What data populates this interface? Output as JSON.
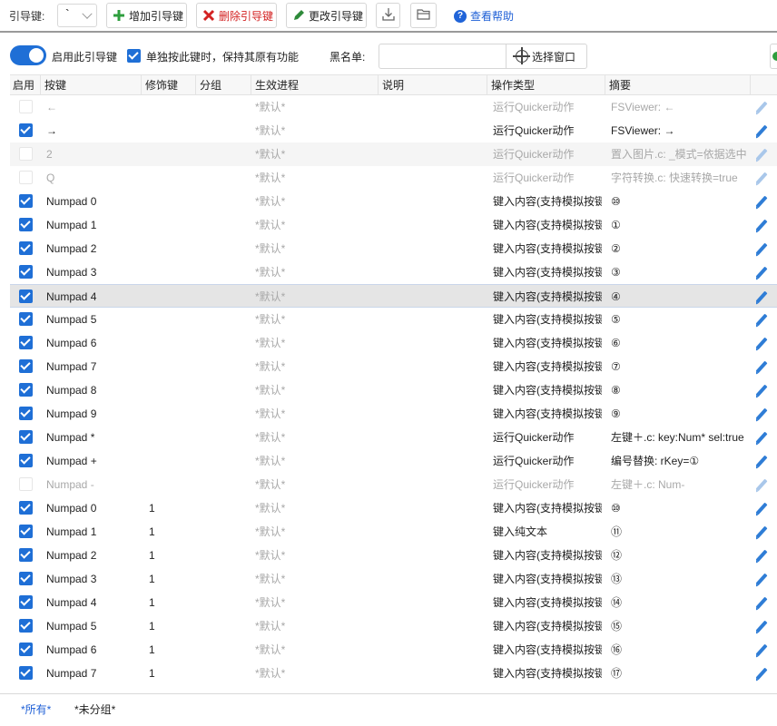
{
  "toolbar": {
    "key_label": "引导键:",
    "key_value": "`",
    "add_label": "增加引导键",
    "delete_label": "删除引导键",
    "edit_label": "更改引导键",
    "help_label": "查看帮助"
  },
  "options": {
    "enable_label": "启用此引导键",
    "keep_label": "单独按此键时，保持其原有功能",
    "blacklist_label": "黑名单:",
    "blacklist_value": "",
    "select_window_label": "选择窗口"
  },
  "columns": [
    "启用",
    "按键",
    "修饰键",
    "分组",
    "生效进程",
    "说明",
    "操作类型",
    "摘要"
  ],
  "rows": [
    {
      "enabled": false,
      "key": "←",
      "mod": "",
      "proc": "*默认*",
      "type": "运行Quicker动作",
      "summary": "FSViewer: ←",
      "disabled": true
    },
    {
      "enabled": true,
      "key": "→",
      "mod": "",
      "proc": "*默认*",
      "type": "运行Quicker动作",
      "summary": "FSViewer: →",
      "disabled": false
    },
    {
      "enabled": false,
      "key": "2",
      "mod": "",
      "proc": "*默认*",
      "type": "运行Quicker动作",
      "summary": "置入图片.c: _模式=依据选中",
      "disabled": true
    },
    {
      "enabled": false,
      "key": "Q",
      "mod": "",
      "proc": "*默认*",
      "type": "运行Quicker动作",
      "summary": "字符转换.c: 快速转换=true",
      "disabled": true
    },
    {
      "enabled": true,
      "key": "Numpad 0",
      "mod": "",
      "proc": "*默认*",
      "type": "键入内容(支持模拟按键)",
      "summary": "⑩",
      "disabled": false
    },
    {
      "enabled": true,
      "key": "Numpad 1",
      "mod": "",
      "proc": "*默认*",
      "type": "键入内容(支持模拟按键)",
      "summary": "①",
      "disabled": false
    },
    {
      "enabled": true,
      "key": "Numpad 2",
      "mod": "",
      "proc": "*默认*",
      "type": "键入内容(支持模拟按键)",
      "summary": "②",
      "disabled": false
    },
    {
      "enabled": true,
      "key": "Numpad 3",
      "mod": "",
      "proc": "*默认*",
      "type": "键入内容(支持模拟按键)",
      "summary": "③",
      "disabled": false
    },
    {
      "enabled": true,
      "key": "Numpad 4",
      "mod": "",
      "proc": "*默认*",
      "type": "键入内容(支持模拟按键)",
      "summary": "④",
      "disabled": false,
      "selected": true
    },
    {
      "enabled": true,
      "key": "Numpad 5",
      "mod": "",
      "proc": "*默认*",
      "type": "键入内容(支持模拟按键)",
      "summary": "⑤",
      "disabled": false
    },
    {
      "enabled": true,
      "key": "Numpad 6",
      "mod": "",
      "proc": "*默认*",
      "type": "键入内容(支持模拟按键)",
      "summary": "⑥",
      "disabled": false
    },
    {
      "enabled": true,
      "key": "Numpad 7",
      "mod": "",
      "proc": "*默认*",
      "type": "键入内容(支持模拟按键)",
      "summary": "⑦",
      "disabled": false
    },
    {
      "enabled": true,
      "key": "Numpad 8",
      "mod": "",
      "proc": "*默认*",
      "type": "键入内容(支持模拟按键)",
      "summary": "⑧",
      "disabled": false
    },
    {
      "enabled": true,
      "key": "Numpad 9",
      "mod": "",
      "proc": "*默认*",
      "type": "键入内容(支持模拟按键)",
      "summary": "⑨",
      "disabled": false
    },
    {
      "enabled": true,
      "key": "Numpad *",
      "mod": "",
      "proc": "*默认*",
      "type": "运行Quicker动作",
      "summary": "左键＋.c: key:Num* sel:true",
      "disabled": false
    },
    {
      "enabled": true,
      "key": "Numpad +",
      "mod": "",
      "proc": "*默认*",
      "type": "运行Quicker动作",
      "summary": "编号替换: rKey=①",
      "disabled": false
    },
    {
      "enabled": false,
      "key": "Numpad -",
      "mod": "",
      "proc": "*默认*",
      "type": "运行Quicker动作",
      "summary": "左键＋.c: Num-",
      "disabled": true
    },
    {
      "enabled": true,
      "key": "Numpad 0",
      "mod": "1",
      "proc": "*默认*",
      "type": "键入内容(支持模拟按键)",
      "summary": "⑩",
      "disabled": false
    },
    {
      "enabled": true,
      "key": "Numpad 1",
      "mod": "1",
      "proc": "*默认*",
      "type": "键入纯文本",
      "summary": "⑪",
      "disabled": false
    },
    {
      "enabled": true,
      "key": "Numpad 2",
      "mod": "1",
      "proc": "*默认*",
      "type": "键入内容(支持模拟按键)",
      "summary": "⑫",
      "disabled": false
    },
    {
      "enabled": true,
      "key": "Numpad 3",
      "mod": "1",
      "proc": "*默认*",
      "type": "键入内容(支持模拟按键)",
      "summary": "⑬",
      "disabled": false
    },
    {
      "enabled": true,
      "key": "Numpad 4",
      "mod": "1",
      "proc": "*默认*",
      "type": "键入内容(支持模拟按键)",
      "summary": "⑭",
      "disabled": false
    },
    {
      "enabled": true,
      "key": "Numpad 5",
      "mod": "1",
      "proc": "*默认*",
      "type": "键入内容(支持模拟按键)",
      "summary": "⑮",
      "disabled": false
    },
    {
      "enabled": true,
      "key": "Numpad 6",
      "mod": "1",
      "proc": "*默认*",
      "type": "键入内容(支持模拟按键)",
      "summary": "⑯",
      "disabled": false
    },
    {
      "enabled": true,
      "key": "Numpad 7",
      "mod": "1",
      "proc": "*默认*",
      "type": "键入内容(支持模拟按键)",
      "summary": "⑰",
      "disabled": false
    }
  ],
  "bottom_tabs": {
    "all": "*所有*",
    "ungrouped": "*未分组*"
  },
  "colors": {
    "accent": "#1f6fd6",
    "danger": "#d32222",
    "link": "#1e5fd6"
  }
}
